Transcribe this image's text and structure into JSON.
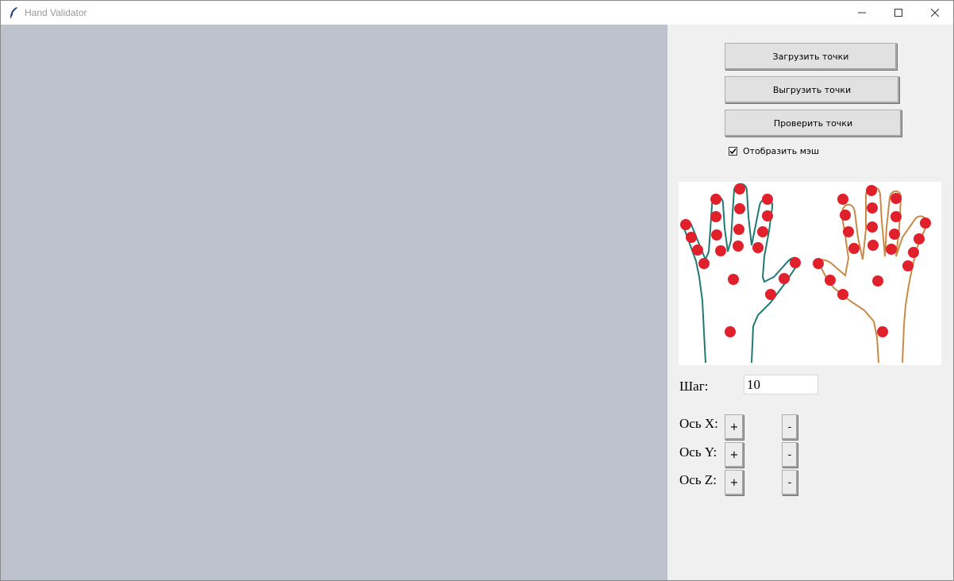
{
  "window": {
    "title": "Hand Validator"
  },
  "panel": {
    "load_label": "Загрузить точки",
    "export_label": "Выгрузить точки",
    "check_label": "Проверить точки",
    "show_mesh": {
      "label": "Отобразить мэш",
      "checked": true
    },
    "step": {
      "label": "Шаг:",
      "value": "10"
    },
    "axes": [
      {
        "label": "Ось X:",
        "plus": "+",
        "minus": "-"
      },
      {
        "label": "Ось Y:",
        "plus": "+",
        "minus": "-"
      },
      {
        "label": "Ось Z:",
        "plus": "+",
        "minus": "-"
      }
    ]
  },
  "colors": {
    "canvas_bg": "#bdc2cc",
    "left_hand": "#1f7a74",
    "right_hand": "#c98a45",
    "points": "#e0202a"
  }
}
